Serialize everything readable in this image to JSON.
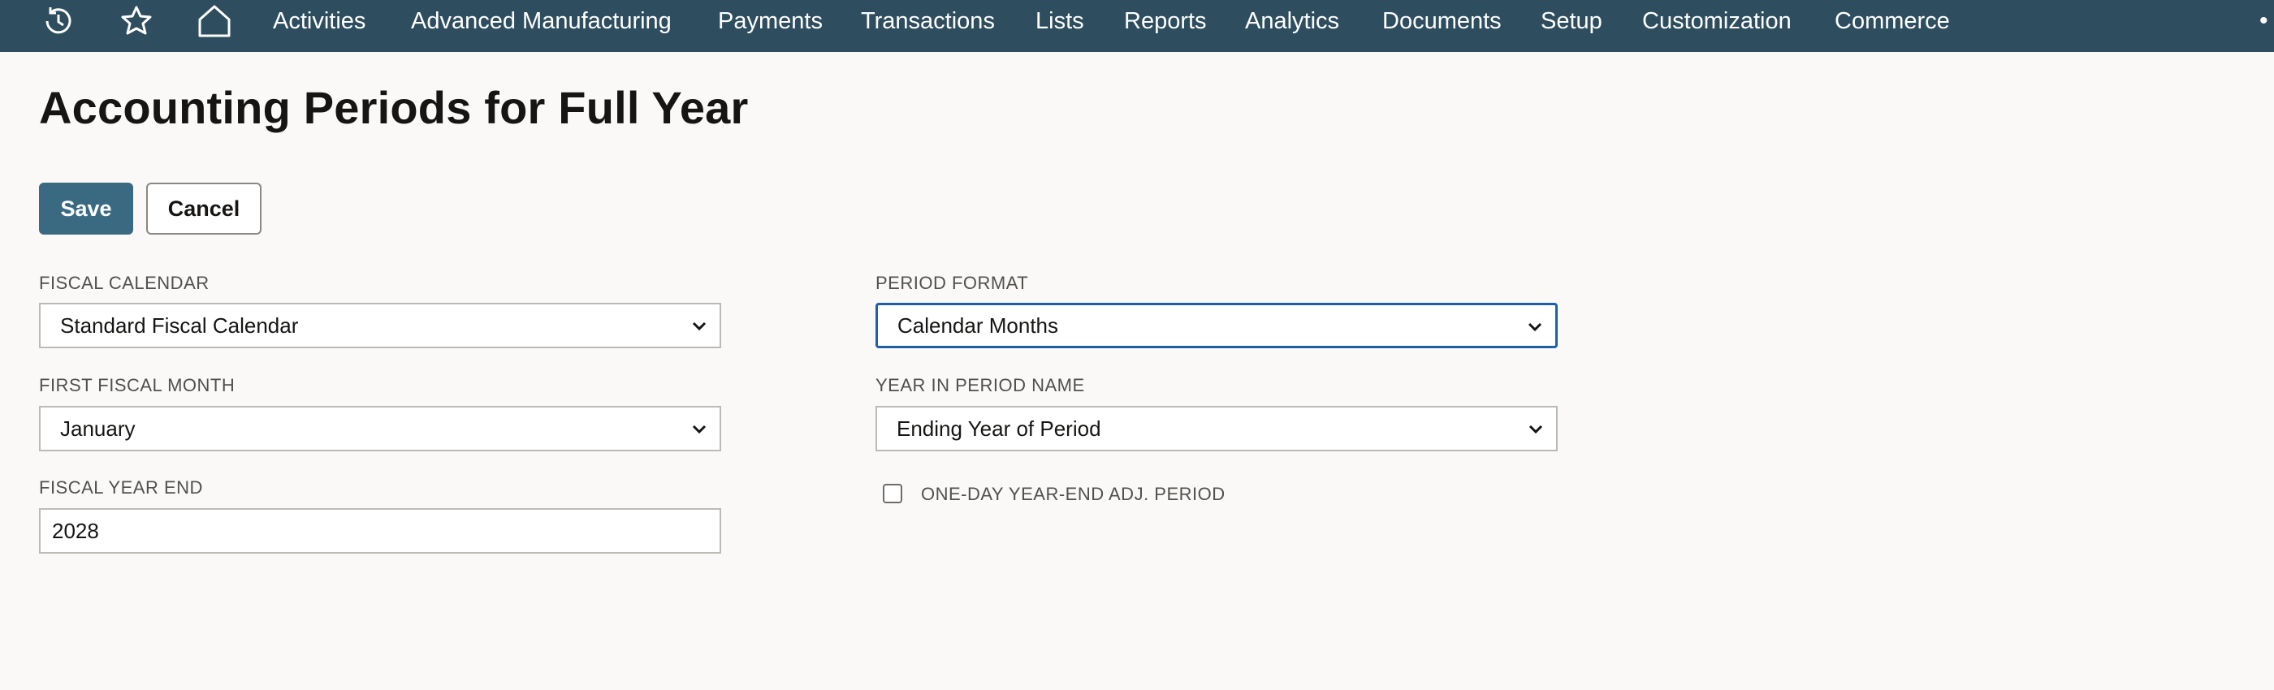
{
  "nav": {
    "icons": [
      "recent-history-icon",
      "star-icon",
      "home-icon"
    ],
    "items": [
      "Activities",
      "Advanced Manufacturing",
      "Payments",
      "Transactions",
      "Lists",
      "Reports",
      "Analytics",
      "Documents",
      "Setup",
      "Customization",
      "Commerce"
    ],
    "colors": {
      "background": "#2e4e60",
      "text": "#ffffff"
    }
  },
  "page": {
    "title": "Accounting Periods for Full Year"
  },
  "actions": {
    "save_label": "Save",
    "cancel_label": "Cancel",
    "save_color": "#3a6a82"
  },
  "form": {
    "fiscal_calendar": {
      "label": "FISCAL CALENDAR",
      "value": "Standard Fiscal Calendar"
    },
    "first_fiscal_month": {
      "label": "FIRST FISCAL MONTH",
      "value": "January"
    },
    "fiscal_year_end": {
      "label": "FISCAL YEAR END",
      "value": "2028"
    },
    "period_format": {
      "label": "PERIOD FORMAT",
      "value": "Calendar Months",
      "focused": true
    },
    "year_in_period_name": {
      "label": "YEAR IN PERIOD NAME",
      "value": "Ending Year of Period"
    },
    "one_day_adj": {
      "label": "ONE-DAY YEAR-END ADJ. PERIOD",
      "checked": false
    }
  }
}
